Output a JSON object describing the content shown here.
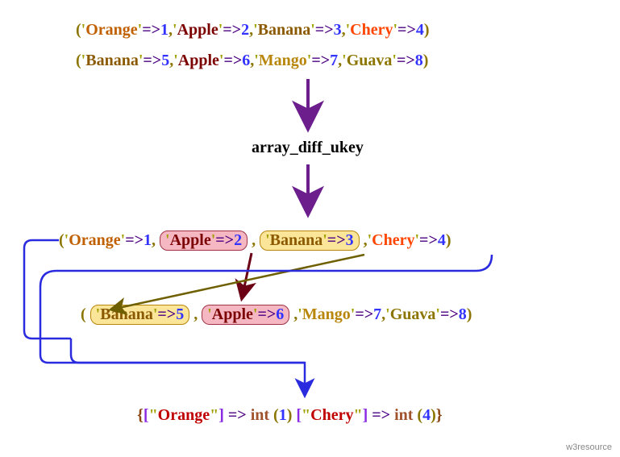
{
  "array1": {
    "k1": "Orange",
    "v1": "1",
    "k2": "Apple",
    "v2": "2",
    "k3": "Banana",
    "v3": "3",
    "k4": "Chery",
    "v4": "4"
  },
  "array2": {
    "k1": "Banana",
    "v1": "5",
    "k2": "Apple",
    "v2": "6",
    "k3": "Mango",
    "v3": "7",
    "k4": "Guava",
    "v4": "8"
  },
  "function_name": "array_diff_ukey",
  "mid1": {
    "k1": "Orange",
    "v1": "1",
    "k2": "Apple",
    "v2": "2",
    "k3": "Banana",
    "v3": "3",
    "k4": "Chery",
    "v4": "4"
  },
  "mid2": {
    "k1": "Banana",
    "v1": "5",
    "k2": "Apple",
    "v2": "6",
    "k3": "Mango",
    "v3": "7",
    "k4": "Guava",
    "v4": "8"
  },
  "result": {
    "k1": "Orange",
    "v1": "1",
    "k2": "Chery",
    "v2": "4",
    "int_label": "int"
  },
  "watermark": "w3resource"
}
